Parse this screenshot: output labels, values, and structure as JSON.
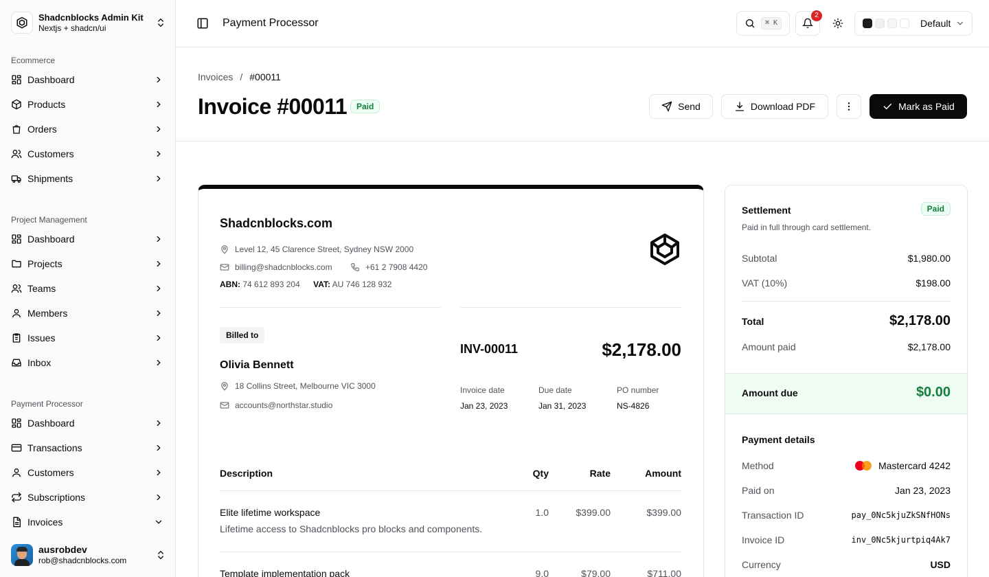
{
  "brand": {
    "title": "Shadcnblocks Admin Kit",
    "subtitle": "Nextjs + shadcn/ui"
  },
  "sidebar": {
    "sections": [
      {
        "label": "Ecommerce",
        "items": [
          "Dashboard",
          "Products",
          "Orders",
          "Customers",
          "Shipments"
        ]
      },
      {
        "label": "Project Management",
        "items": [
          "Dashboard",
          "Projects",
          "Teams",
          "Members",
          "Issues",
          "Inbox"
        ]
      },
      {
        "label": "Payment Processor",
        "items": [
          "Dashboard",
          "Transactions",
          "Customers",
          "Subscriptions",
          "Invoices"
        ]
      }
    ]
  },
  "user": {
    "name": "ausrobdev",
    "email": "rob@shadcnblocks.com"
  },
  "topbar": {
    "title": "Payment Processor",
    "kbd": "⌘ K",
    "notifications": "2",
    "theme": "Default"
  },
  "page": {
    "crumb_parent": "Invoices",
    "crumb_sep": "/",
    "crumb_current": "#00011",
    "title": "Invoice #00011",
    "status": "Paid",
    "send_label": "Send",
    "download_label": "Download PDF",
    "mark_label": "Mark as Paid"
  },
  "invoice": {
    "company": "Shadcnblocks.com",
    "address": "Level 12, 45 Clarence Street, Sydney NSW 2000",
    "email": "billing@shadcnblocks.com",
    "phone": "+61 2 7908 4420",
    "abn_label": "ABN:",
    "abn": "74 612 893 204",
    "vat_label": "VAT:",
    "vat": "AU 746 128 932",
    "billed_to_label": "Billed to",
    "client_name": "Olivia Bennett",
    "client_address": "18 Collins Street, Melbourne VIC 3000",
    "client_email": "accounts@northstar.studio",
    "number": "INV-00011",
    "total": "$2,178.00",
    "invoice_date_label": "Invoice date",
    "invoice_date": "Jan 23, 2023",
    "due_date_label": "Due date",
    "due_date": "Jan 31, 2023",
    "po_label": "PO number",
    "po": "NS-4826",
    "columns": {
      "description": "Description",
      "qty": "Qty",
      "rate": "Rate",
      "amount": "Amount"
    },
    "lines": [
      {
        "title": "Elite lifetime workspace",
        "desc": "Lifetime access to Shadcnblocks pro blocks and components.",
        "qty": "1.0",
        "rate": "$399.00",
        "amount": "$399.00"
      },
      {
        "title": "Template implementation pack",
        "desc": "",
        "qty": "9.0",
        "rate": "$79.00",
        "amount": "$711.00"
      }
    ]
  },
  "settlement": {
    "title": "Settlement",
    "status": "Paid",
    "subtitle": "Paid in full through card settlement.",
    "subtotal_label": "Subtotal",
    "subtotal": "$1,980.00",
    "vat_label": "VAT (10%)",
    "vat": "$198.00",
    "total_label": "Total",
    "total": "$2,178.00",
    "paid_label": "Amount paid",
    "paid": "$2,178.00",
    "due_label": "Amount due",
    "due": "$0.00",
    "details_title": "Payment details",
    "method_label": "Method",
    "method": "Mastercard 4242",
    "paid_on_label": "Paid on",
    "paid_on": "Jan 23, 2023",
    "txn_label": "Transaction ID",
    "txn": "pay_0Nc5kjuZkSNfHONs",
    "inv_id_label": "Invoice ID",
    "inv_id": "inv_0Nc5kjurtpiq4Ak7",
    "currency_label": "Currency",
    "currency": "USD"
  },
  "colors": {
    "accent": "#0a0a0a",
    "paid_green": "#15803d",
    "due_band": "#effcf4",
    "badge_red": "#dc2626"
  }
}
